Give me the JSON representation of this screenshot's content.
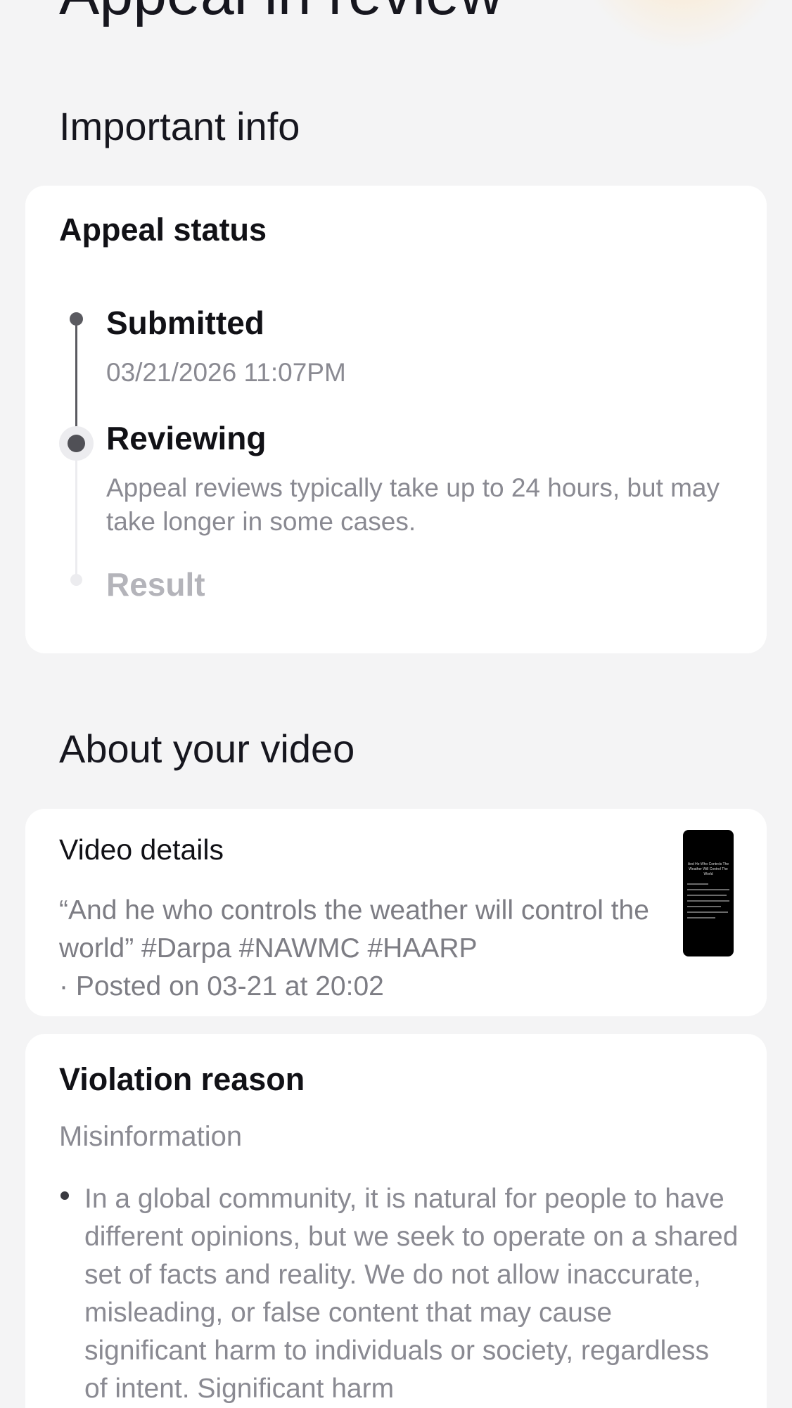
{
  "header": {
    "title": "Appeal in review"
  },
  "important_info": {
    "heading": "Important info",
    "card_title": "Appeal status",
    "steps": [
      {
        "label": "Submitted",
        "detail": "03/21/2026 11:07PM",
        "state": "done"
      },
      {
        "label": "Reviewing",
        "detail": "Appeal reviews typically take up to 24 hours, but may take longer in some cases.",
        "state": "current"
      },
      {
        "label": "Result",
        "detail": "",
        "state": "pending"
      }
    ]
  },
  "about_video": {
    "heading": "About your video",
    "card_title": "Video details",
    "caption": "“And he who controls the weather will control the world” #Darpa #NAWMC #HAARP",
    "posted": "· Posted on 03-21 at 20:02",
    "thumbnail_text": "And He Who Controls The Weather Will Control The World"
  },
  "violation": {
    "title": "Violation reason",
    "category": "Misinformation",
    "bullets": [
      "In a global community, it is natural for people to have different opinions, but we seek to operate on a shared set of facts and reality. We do not allow inaccurate, misleading, or false content that may cause significant harm to individuals or society, regardless of intent. Significant harm"
    ]
  },
  "colors": {
    "background": "#f4f4f5",
    "card": "#ffffff",
    "timeline_done": "#5a5a60",
    "timeline_pending": "#e6e6e9",
    "muted_text": "#8a8a92",
    "pending_text": "#b4b4ba"
  }
}
